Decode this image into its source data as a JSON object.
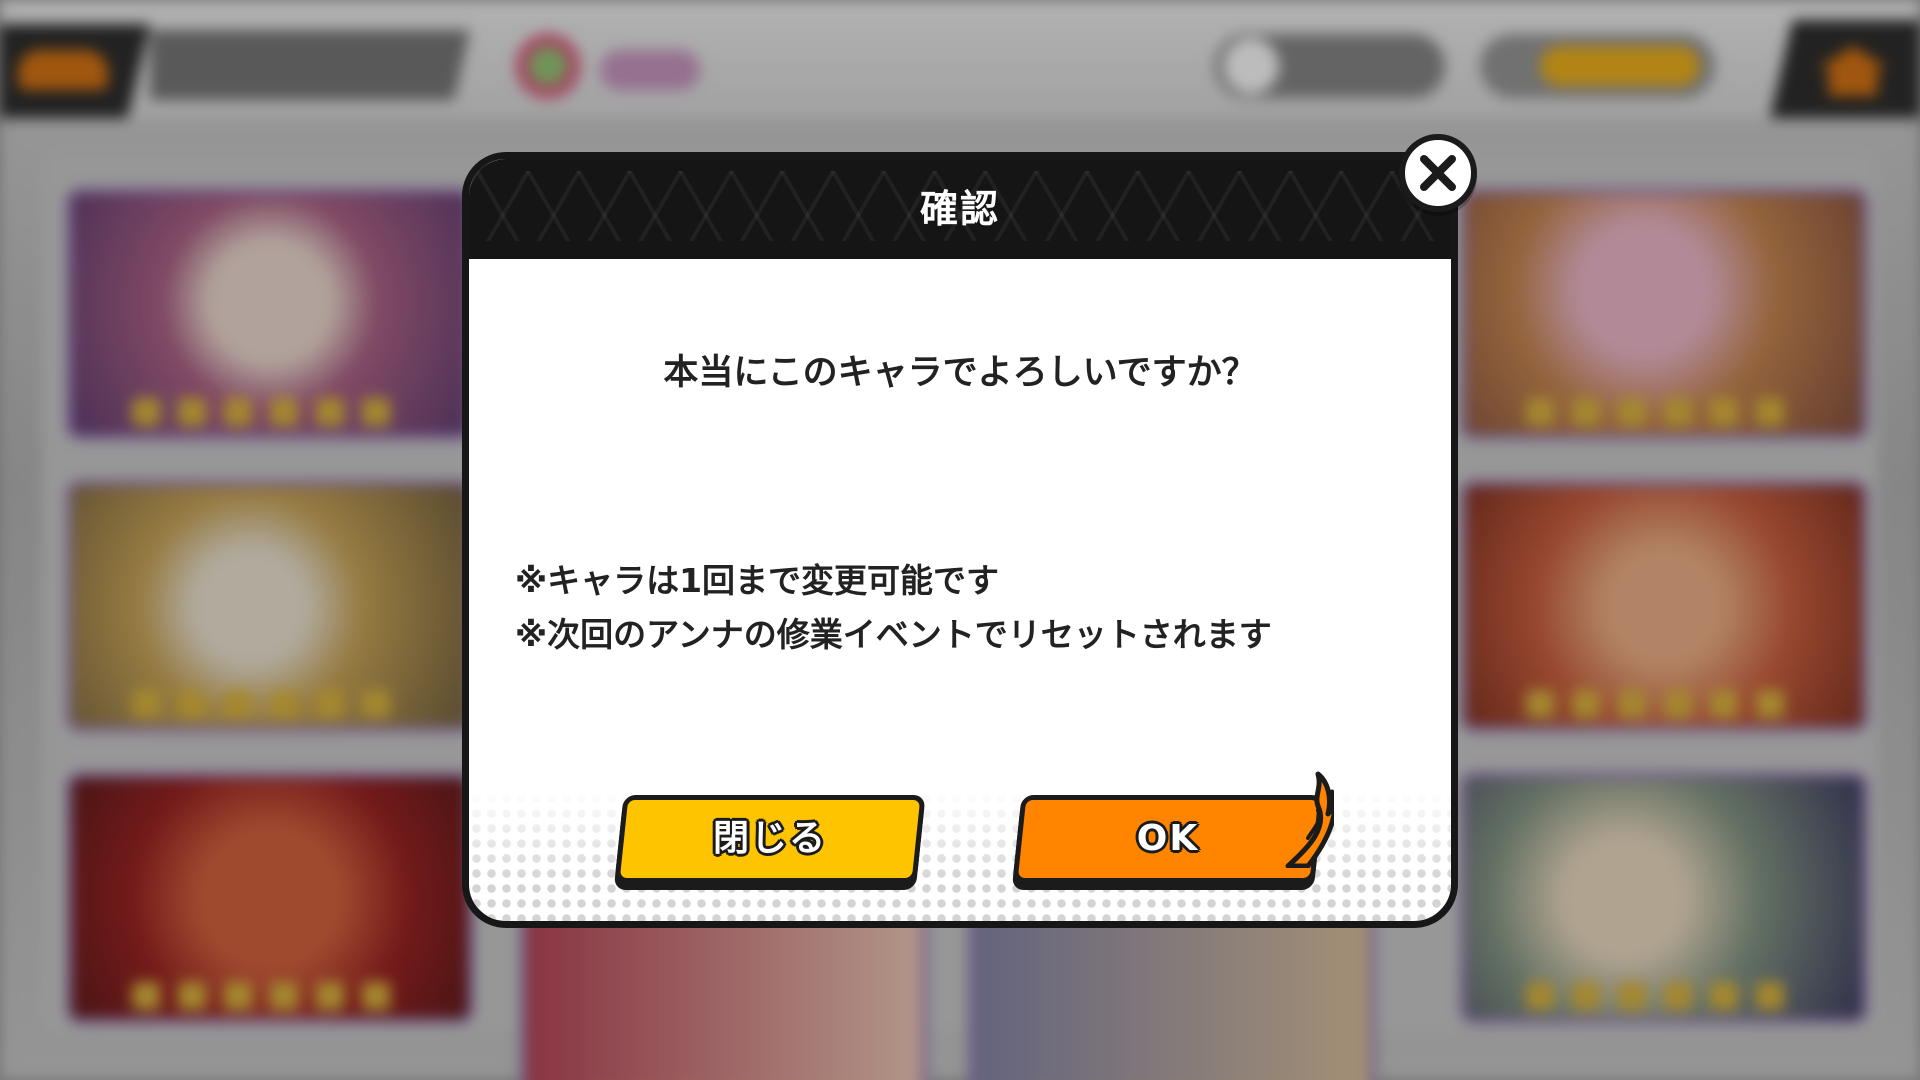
{
  "dialog": {
    "title": "確認",
    "question": "本当にこのキャラでよろしいですか？",
    "notes": [
      "※キャラは1回まで変更可能です",
      "※次回のアンナの修業イベントでリセットされます"
    ],
    "close_label": "閉じる",
    "ok_label": "OK"
  },
  "icons": {
    "close": "close-icon",
    "flame": "flame-icon"
  },
  "colors": {
    "close_button": "#ffc400",
    "ok_button": "#ff8400",
    "header": "#151515"
  }
}
